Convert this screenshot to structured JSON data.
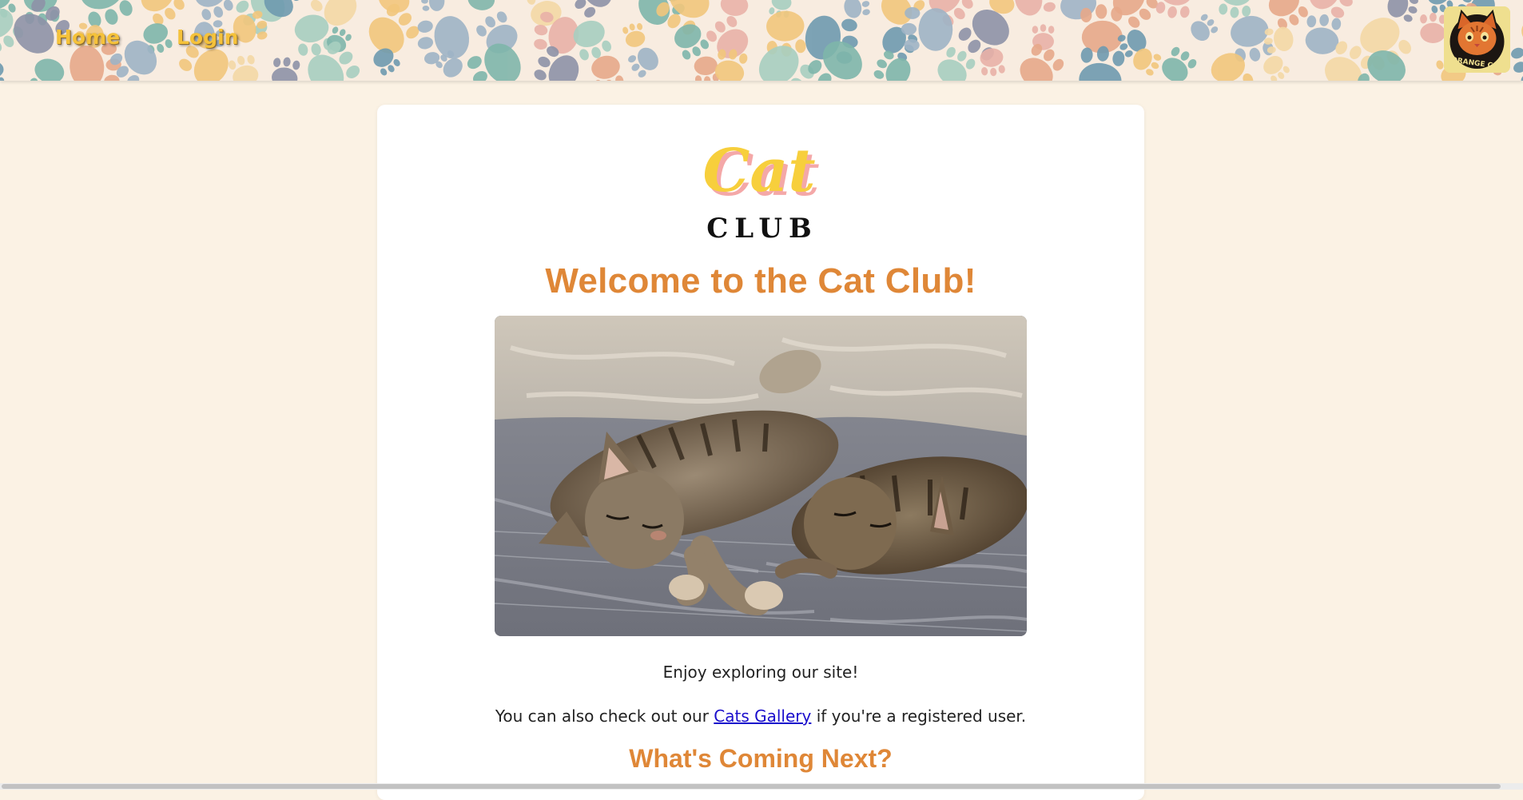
{
  "nav": {
    "home_label": "Home",
    "login_label": "Login",
    "avatar_text": "ORANGE CAT"
  },
  "logo": {
    "word_top": "Cat",
    "word_bottom": "CLUB"
  },
  "main": {
    "title": "Welcome to the Cat Club!",
    "hero_image": "sleeping-kittens-photo",
    "enjoy_text": "Enjoy exploring our site!",
    "gallery_prefix": "You can also check out our ",
    "gallery_link": "Cats Gallery",
    "gallery_suffix": " if you're a registered user.",
    "next_heading": "What's Coming Next?"
  },
  "colors": {
    "page_bg": "#fbf2e4",
    "accent_orange": "#df8737",
    "nav_link": "#f5c23a",
    "link_blue": "#1a0dcc"
  }
}
